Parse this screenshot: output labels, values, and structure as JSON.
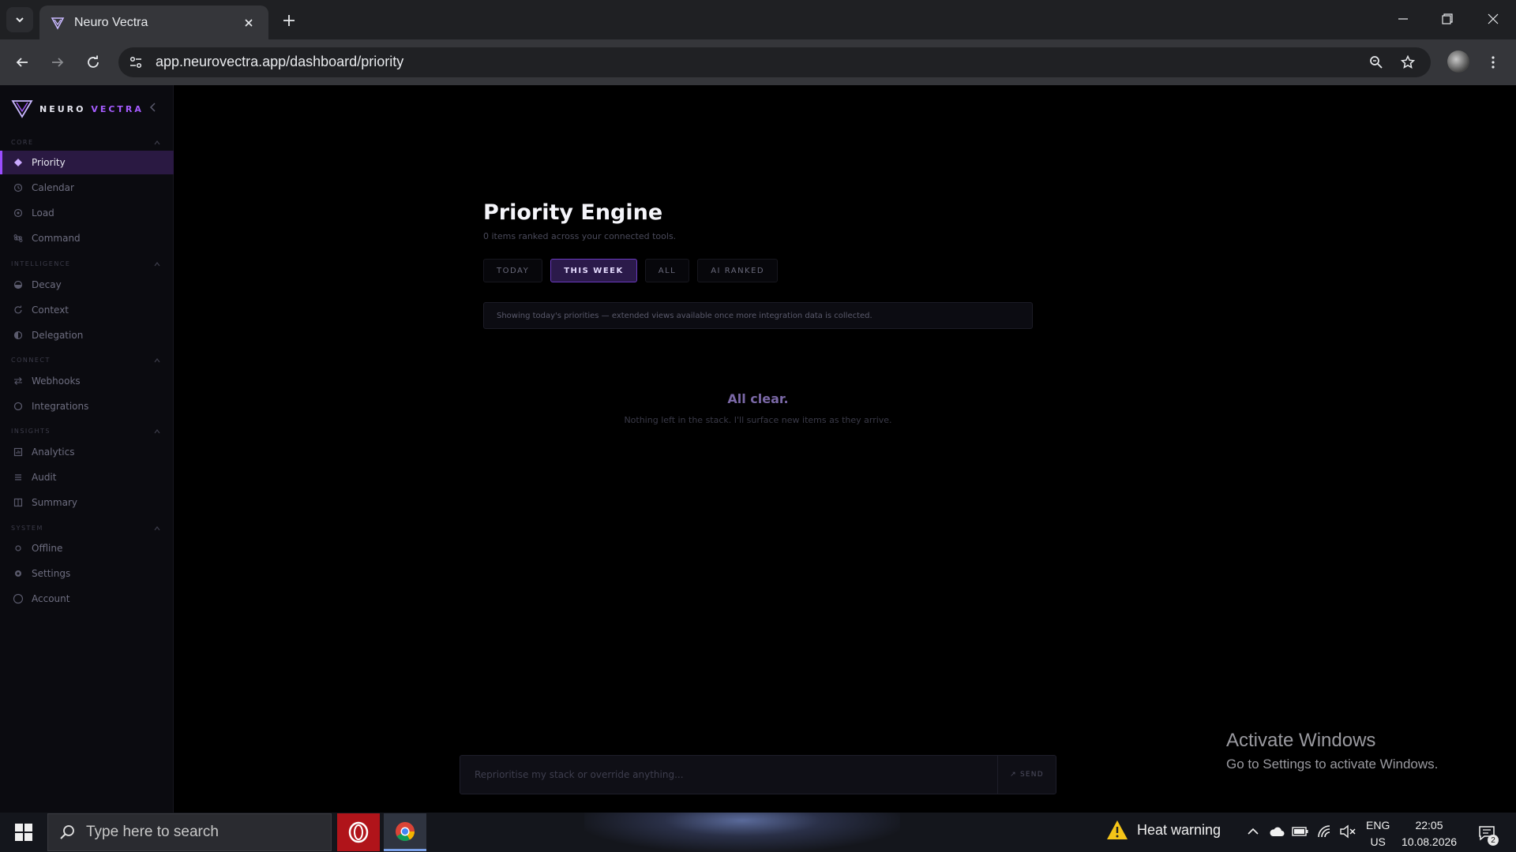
{
  "browser": {
    "tab_title": "Neuro Vectra",
    "url": "app.neurovectra.app/dashboard/priority"
  },
  "app": {
    "brand_first": "NEURO",
    "brand_second": "VECTRA",
    "accent_color": "#9b4dff"
  },
  "sidebar": {
    "sections": [
      {
        "label": "CORE",
        "items": [
          {
            "label": "Priority",
            "icon": "diamond-icon",
            "active": true
          },
          {
            "label": "Calendar",
            "icon": "clock-icon"
          },
          {
            "label": "Load",
            "icon": "gauge-icon"
          },
          {
            "label": "Command",
            "icon": "command-icon"
          }
        ]
      },
      {
        "label": "INTELLIGENCE",
        "items": [
          {
            "label": "Decay",
            "icon": "half-circle-icon"
          },
          {
            "label": "Context",
            "icon": "refresh-icon"
          },
          {
            "label": "Delegation",
            "icon": "contrast-icon"
          }
        ]
      },
      {
        "label": "CONNECT",
        "items": [
          {
            "label": "Webhooks",
            "icon": "arrows-swap-icon"
          },
          {
            "label": "Integrations",
            "icon": "ring-icon"
          }
        ]
      },
      {
        "label": "INSIGHTS",
        "items": [
          {
            "label": "Analytics",
            "icon": "chart-box-icon"
          },
          {
            "label": "Audit",
            "icon": "list-icon"
          },
          {
            "label": "Summary",
            "icon": "book-icon"
          }
        ]
      },
      {
        "label": "SYSTEM",
        "items": [
          {
            "label": "Offline",
            "icon": "dot-icon"
          },
          {
            "label": "Settings",
            "icon": "gear-icon"
          },
          {
            "label": "Account",
            "icon": "user-circle-icon"
          }
        ]
      }
    ]
  },
  "main": {
    "title": "Priority Engine",
    "subtitle": "0 items ranked across your connected tools.",
    "filter_tabs": [
      {
        "label": "TODAY",
        "active": false
      },
      {
        "label": "THIS WEEK",
        "active": true
      },
      {
        "label": "ALL",
        "active": false
      },
      {
        "label": "AI RANKED",
        "active": false
      }
    ],
    "notice": "Showing today's priorities — extended views available once more integration data is collected.",
    "empty_title": "All clear.",
    "empty_subtitle": "Nothing left in the stack. I'll surface new items as they arrive."
  },
  "chat": {
    "placeholder": "Reprioritise my stack or override anything...",
    "send_label": "↗ SEND"
  },
  "watermark": {
    "title": "Activate Windows",
    "subtitle": "Go to Settings to activate Windows."
  },
  "taskbar": {
    "search_placeholder": "Type here to search",
    "weather": "Heat warning",
    "lang_top": "ENG",
    "lang_bottom": "US",
    "time": "22:05",
    "date": "10.08.2026",
    "notification_count": "2"
  }
}
